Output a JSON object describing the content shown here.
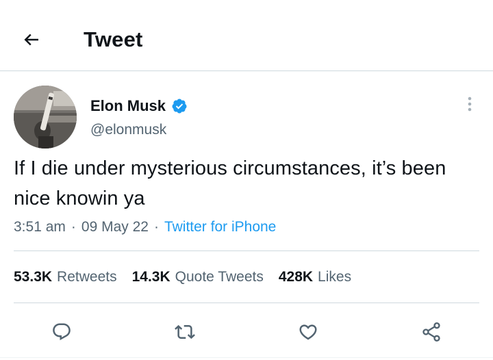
{
  "header": {
    "title": "Tweet",
    "back_icon": "arrow-left-icon"
  },
  "author": {
    "name": "Elon Musk",
    "handle": "@elonmusk",
    "verified": true,
    "verified_color": "#1d9bf0"
  },
  "tweet": {
    "text": "If I die under mysterious circumstances, it’s been nice knowin ya",
    "time": "3:51 am",
    "separator": "·",
    "date": "09 May 22",
    "source": "Twitter for iPhone"
  },
  "stats": {
    "retweets": {
      "count": "53.3K",
      "label": "Retweets"
    },
    "quote_tweets": {
      "count": "14.3K",
      "label": "Quote Tweets"
    },
    "likes": {
      "count": "428K",
      "label": "Likes"
    }
  },
  "actions": [
    "reply-icon",
    "retweet-icon",
    "like-icon",
    "share-icon"
  ],
  "colors": {
    "accent": "#1d9bf0",
    "text": "#0f1419",
    "secondary": "#536471",
    "border": "#cfd9de"
  }
}
